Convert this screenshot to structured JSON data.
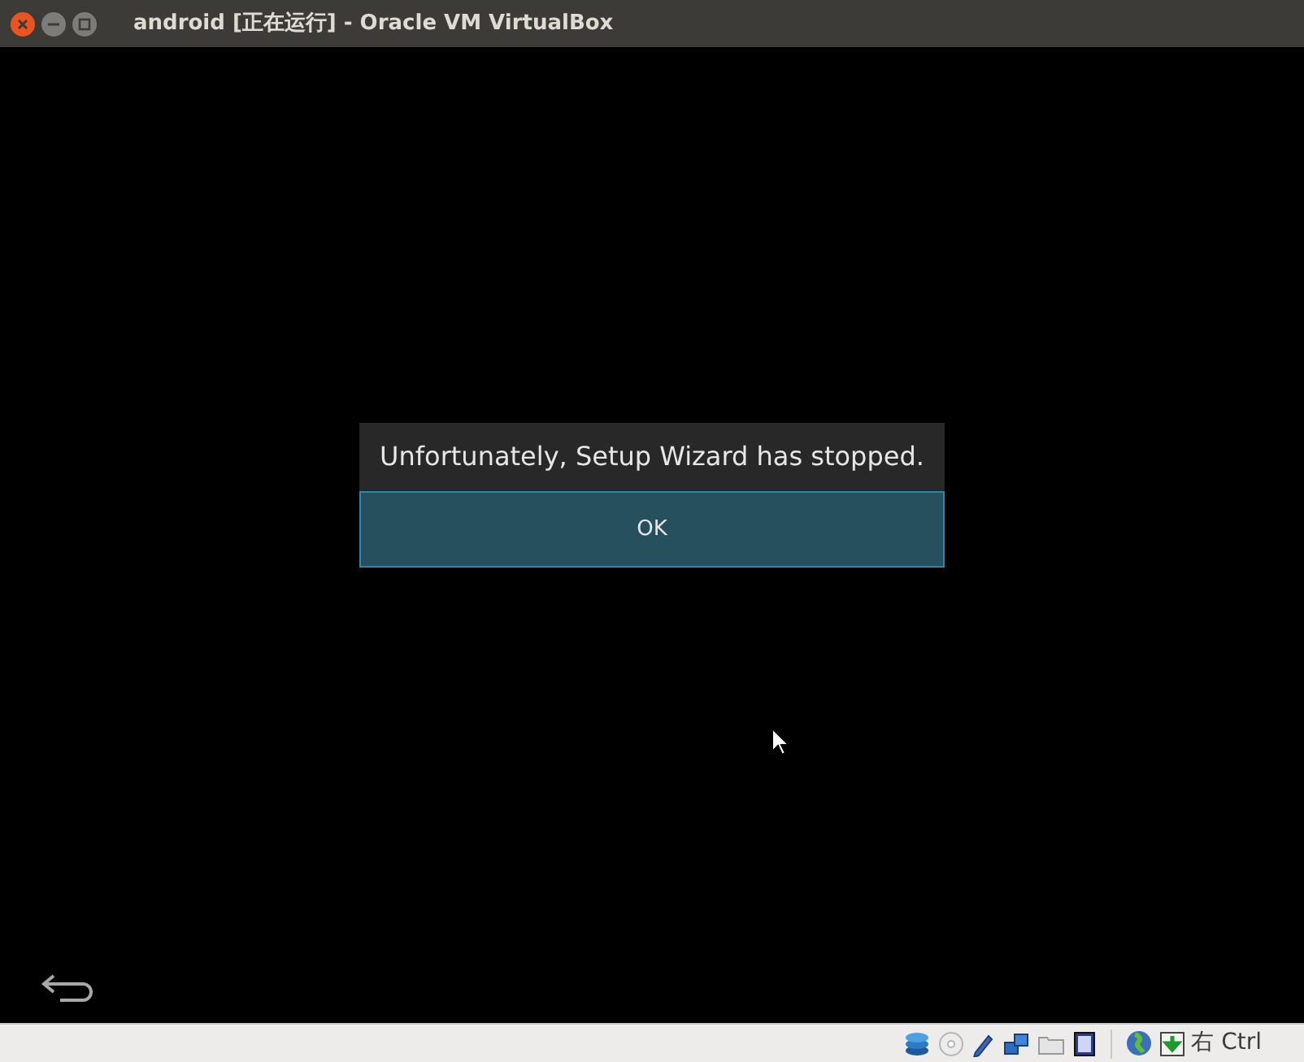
{
  "window": {
    "title": "android [正在运行] - Oracle VM VirtualBox"
  },
  "dialog": {
    "message": "Unfortunately, Setup Wizard has stopped.",
    "button": "OK"
  },
  "status_bar": {
    "host_key": "右 Ctrl"
  }
}
